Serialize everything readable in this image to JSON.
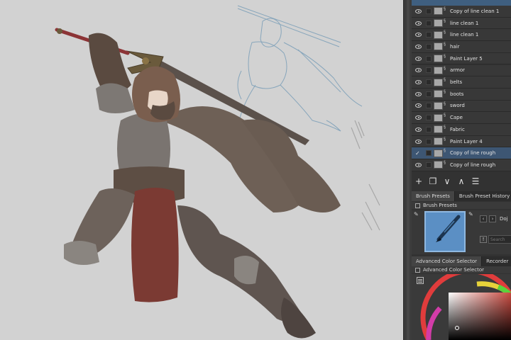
{
  "layers": [
    {
      "name": "Copy of line clean 1",
      "visible": true,
      "selected": false
    },
    {
      "name": "line clean 1",
      "visible": true,
      "selected": false
    },
    {
      "name": "line clean 1",
      "visible": true,
      "selected": false
    },
    {
      "name": "hair",
      "visible": true,
      "selected": false
    },
    {
      "name": "Paint Layer 5",
      "visible": true,
      "selected": false
    },
    {
      "name": "armor",
      "visible": true,
      "selected": false
    },
    {
      "name": "belts",
      "visible": true,
      "selected": false
    },
    {
      "name": "boots",
      "visible": true,
      "selected": false
    },
    {
      "name": "sword",
      "visible": true,
      "selected": false
    },
    {
      "name": "Cape",
      "visible": true,
      "selected": false
    },
    {
      "name": "Fabric",
      "visible": true,
      "selected": false
    },
    {
      "name": "Paint Layer 4",
      "visible": true,
      "selected": false
    },
    {
      "name": "Copy of line rough",
      "visible": true,
      "selected": true
    },
    {
      "name": "Copy of line rough",
      "visible": true,
      "selected": false
    }
  ],
  "layer_tools": [
    {
      "icon": "add-layer-icon",
      "glyph": "+"
    },
    {
      "icon": "duplicate-layer-icon",
      "glyph": "❐"
    },
    {
      "icon": "move-down-icon",
      "glyph": "∨"
    },
    {
      "icon": "move-up-icon",
      "glyph": "∧"
    },
    {
      "icon": "layer-properties-icon",
      "glyph": "☰"
    }
  ],
  "brush_tabs": {
    "presets": "Brush Presets",
    "history": "Brush Preset History"
  },
  "brush_panel": {
    "title": "Brush Presets",
    "preset_name": "Doj",
    "search_placeholder": "Search"
  },
  "color_tabs": {
    "selector": "Advanced Color Selector",
    "recorder": "Recorder"
  },
  "color_panel": {
    "title": "Advanced Color Selector"
  },
  "colors": {
    "canvas": "#d2d2d2",
    "panel": "#323232",
    "selected_row": "#3d5673",
    "preset_blue": "#5b8fc4"
  }
}
